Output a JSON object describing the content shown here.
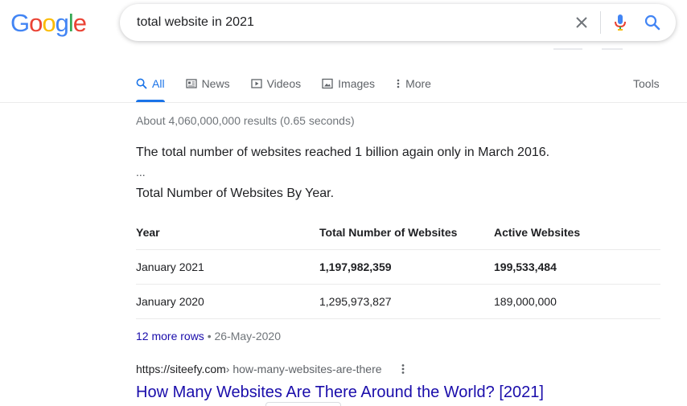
{
  "logo": {
    "letters": [
      "G",
      "o",
      "o",
      "g",
      "l",
      "e"
    ],
    "colors": [
      "#4285F4",
      "#EA4335",
      "#FBBC05",
      "#4285F4",
      "#34A853",
      "#EA4335"
    ]
  },
  "search": {
    "query": "total website in 2021"
  },
  "tabs": [
    {
      "label": "All",
      "icon": "search-icon",
      "active": true
    },
    {
      "label": "News",
      "icon": "news-icon",
      "active": false
    },
    {
      "label": "Videos",
      "icon": "video-icon",
      "active": false
    },
    {
      "label": "Images",
      "icon": "image-icon",
      "active": false
    },
    {
      "label": "More",
      "icon": "more-vert-icon",
      "active": false
    }
  ],
  "tools_label": "Tools",
  "result_stats": "About 4,060,000,000 results (0.65 seconds)",
  "snippet": {
    "text": "The total number of websites reached 1 billion again only in March 2016.",
    "ellipsis": "...",
    "heading": "Total Number of Websites By Year.",
    "table": {
      "headers": [
        "Year",
        "Total Number of Websites",
        "Active Websites"
      ],
      "rows": [
        [
          "January 2021",
          "1,197,982,359",
          "199,533,484"
        ],
        [
          "January 2020",
          "1,295,973,827",
          "189,000,000"
        ]
      ]
    },
    "more_rows": "12 more rows",
    "date": "26-May-2020"
  },
  "result": {
    "url_base": "https://siteefy.com",
    "url_path": " › how-many-websites-are-there",
    "title": "How Many Websites Are There Around the World? [2021]"
  },
  "colors": {
    "link": "#1a0dab",
    "accent": "#1a73e8",
    "muted": "#70757a"
  }
}
